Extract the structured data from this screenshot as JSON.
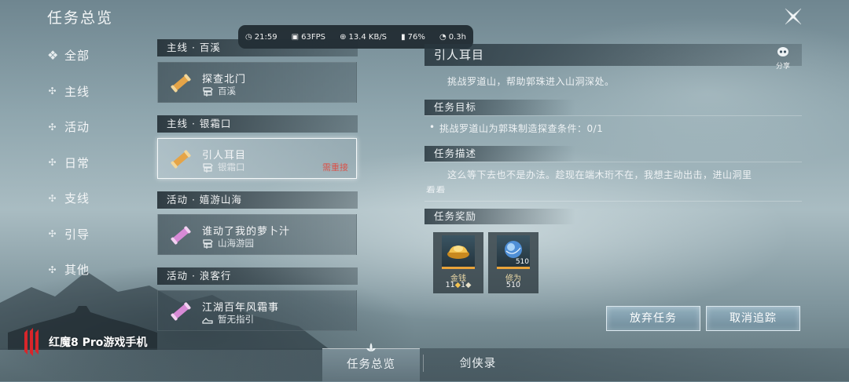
{
  "header": {
    "title": "任务总览"
  },
  "status_bar": {
    "time": "21:59",
    "fps": "63FPS",
    "network": "13.4 KB/S",
    "battery": "76%",
    "duration": "0.3h"
  },
  "categories": [
    {
      "label": "全部",
      "active": true
    },
    {
      "label": "主线"
    },
    {
      "label": "活动"
    },
    {
      "label": "日常"
    },
    {
      "label": "支线"
    },
    {
      "label": "引导"
    },
    {
      "label": "其他"
    }
  ],
  "task_sections": [
    {
      "header": "主线 · 百溪",
      "task": {
        "name": "探查北门",
        "location": "百溪"
      }
    },
    {
      "header": "主线 · 银霜口",
      "task": {
        "name": "引人耳目",
        "location": "银霜口",
        "badge": "需重接"
      }
    },
    {
      "header": "活动 · 嬉游山海",
      "task": {
        "name": "谁动了我的萝卜汁",
        "location": "山海游园"
      }
    },
    {
      "header": "活动 · 浪客行",
      "task": {
        "name": "江湖百年风霜事",
        "location": "暂无指引"
      }
    }
  ],
  "detail": {
    "title": "引人耳目",
    "share_label": "分享",
    "summary": "挑战罗道山，帮助郭珠进入山洞深处。",
    "objective_head": "任务目标",
    "objective": "挑战罗道山为郭珠制造探查条件：0/1",
    "description_head": "任务描述",
    "description_line1": "这么等下去也不是办法。趁现在端木珩不在，我想主动出击，进山洞里",
    "description_line2": "看看",
    "reward_head": "任务奖励",
    "rewards": [
      {
        "name": "金钱",
        "value": "11",
        "value_tail": "1",
        "icon": "gold-ingot-icon"
      },
      {
        "name": "修为",
        "value": "510",
        "count": "510",
        "icon": "cultivation-orb-icon"
      }
    ]
  },
  "buttons": {
    "abandon": "放弃任务",
    "untrack": "取消追踪"
  },
  "tabs": [
    {
      "label": "任务总览",
      "active": true
    },
    {
      "label": "剑侠录"
    }
  ],
  "watermark": {
    "text": "红魔8 Pro游戏手机"
  },
  "colors": {
    "accent_badge": "#d9534a",
    "button": "#8fb0c2",
    "reward_bar": "#e8a33a"
  }
}
